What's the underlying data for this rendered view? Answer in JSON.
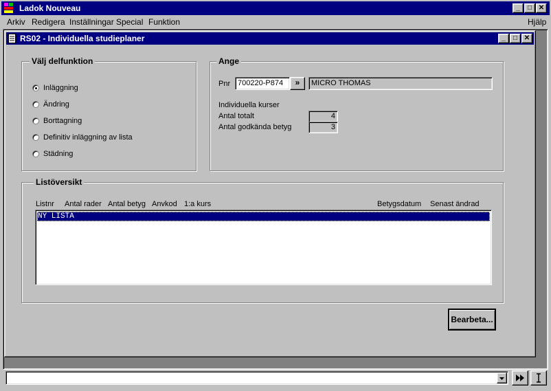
{
  "app": {
    "title": "Ladok Nouveau",
    "menu": [
      "Arkiv",
      "Redigera",
      "Inställningar",
      "Special",
      "Funktion"
    ],
    "menu_help": "Hjälp"
  },
  "window": {
    "title": "RS02 - Individuella studieplaner"
  },
  "subfunction": {
    "label": "Välj delfunktion",
    "options": [
      {
        "label": "Inläggning",
        "checked": true
      },
      {
        "label": "Ändring",
        "checked": false
      },
      {
        "label": "Borttagning",
        "checked": false
      },
      {
        "label": "Definitiv inläggning av lista",
        "checked": false
      },
      {
        "label": "Städning",
        "checked": false
      }
    ]
  },
  "ange": {
    "label": "Ange",
    "pnr_label": "Pnr",
    "pnr_value": "700220-P874",
    "lookup_button": "»",
    "name_value": "MICRO THOMAS",
    "courses_heading": "Individuella kurser",
    "total_label": "Antal totalt",
    "total_value": "4",
    "approved_label": "Antal godkända betyg",
    "approved_value": "3"
  },
  "list_overview": {
    "label": "Listöversikt",
    "columns": [
      "Listnr",
      "Antal rader",
      "Antal betyg",
      "Anvkod",
      "1:a kurs",
      "Betygsdatum",
      "Senast ändrad"
    ],
    "rows": [
      "NY LISTA"
    ]
  },
  "actions": {
    "process_button": "Bearbeta..."
  },
  "statusbar": {
    "command_value": ""
  }
}
